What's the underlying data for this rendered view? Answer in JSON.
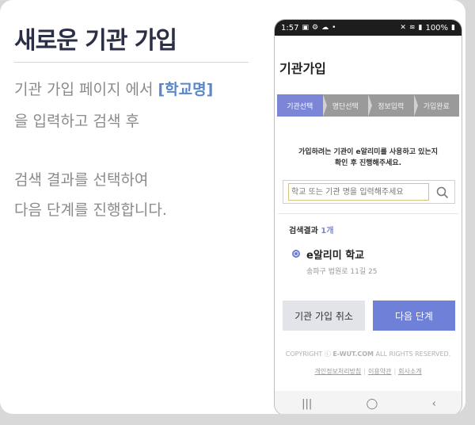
{
  "heading": "새로운 기관 가입",
  "description": {
    "line1_pre": "기관 가입 페이지 에서 ",
    "line1_highlight": "[학교명]",
    "line2": "을 입력하고 검색 후",
    "line3": "검색 결과를 선택하여",
    "line4": "다음 단계를 진행합니다."
  },
  "phone": {
    "status": {
      "time": "1:57",
      "battery": "100%"
    },
    "title": "기관가입",
    "steps": [
      "기관선택",
      "명단선택",
      "정보입력",
      "가입완료"
    ],
    "active_step": 0,
    "instruction_line1": "가입하려는 기관이 e알리미를 사용하고 있는지",
    "instruction_line2": "확인 후 진행해주세요.",
    "search": {
      "placeholder": "학교 또는 기관 명을 입력해주세요"
    },
    "results": {
      "label": "검색결과",
      "count": "1개"
    },
    "school": {
      "name": "e알리미 학교",
      "address": "송파구 법원로 11길 25"
    },
    "buttons": {
      "cancel": "기관 가입 취소",
      "next": "다음 단계"
    },
    "copyright_pre": "COPYRIGHT ⓒ ",
    "copyright_brand": "E-WUT.COM",
    "copyright_post": " ALL RIGHTS RESERVED.",
    "links": [
      "개인정보처리방침",
      "이용약관",
      "회사소개"
    ],
    "nav": [
      "|||",
      "◯",
      "‹"
    ]
  },
  "colors": {
    "accent": "#7b87d6",
    "highlight": "#5b86c9",
    "heading": "#2a2f45"
  }
}
